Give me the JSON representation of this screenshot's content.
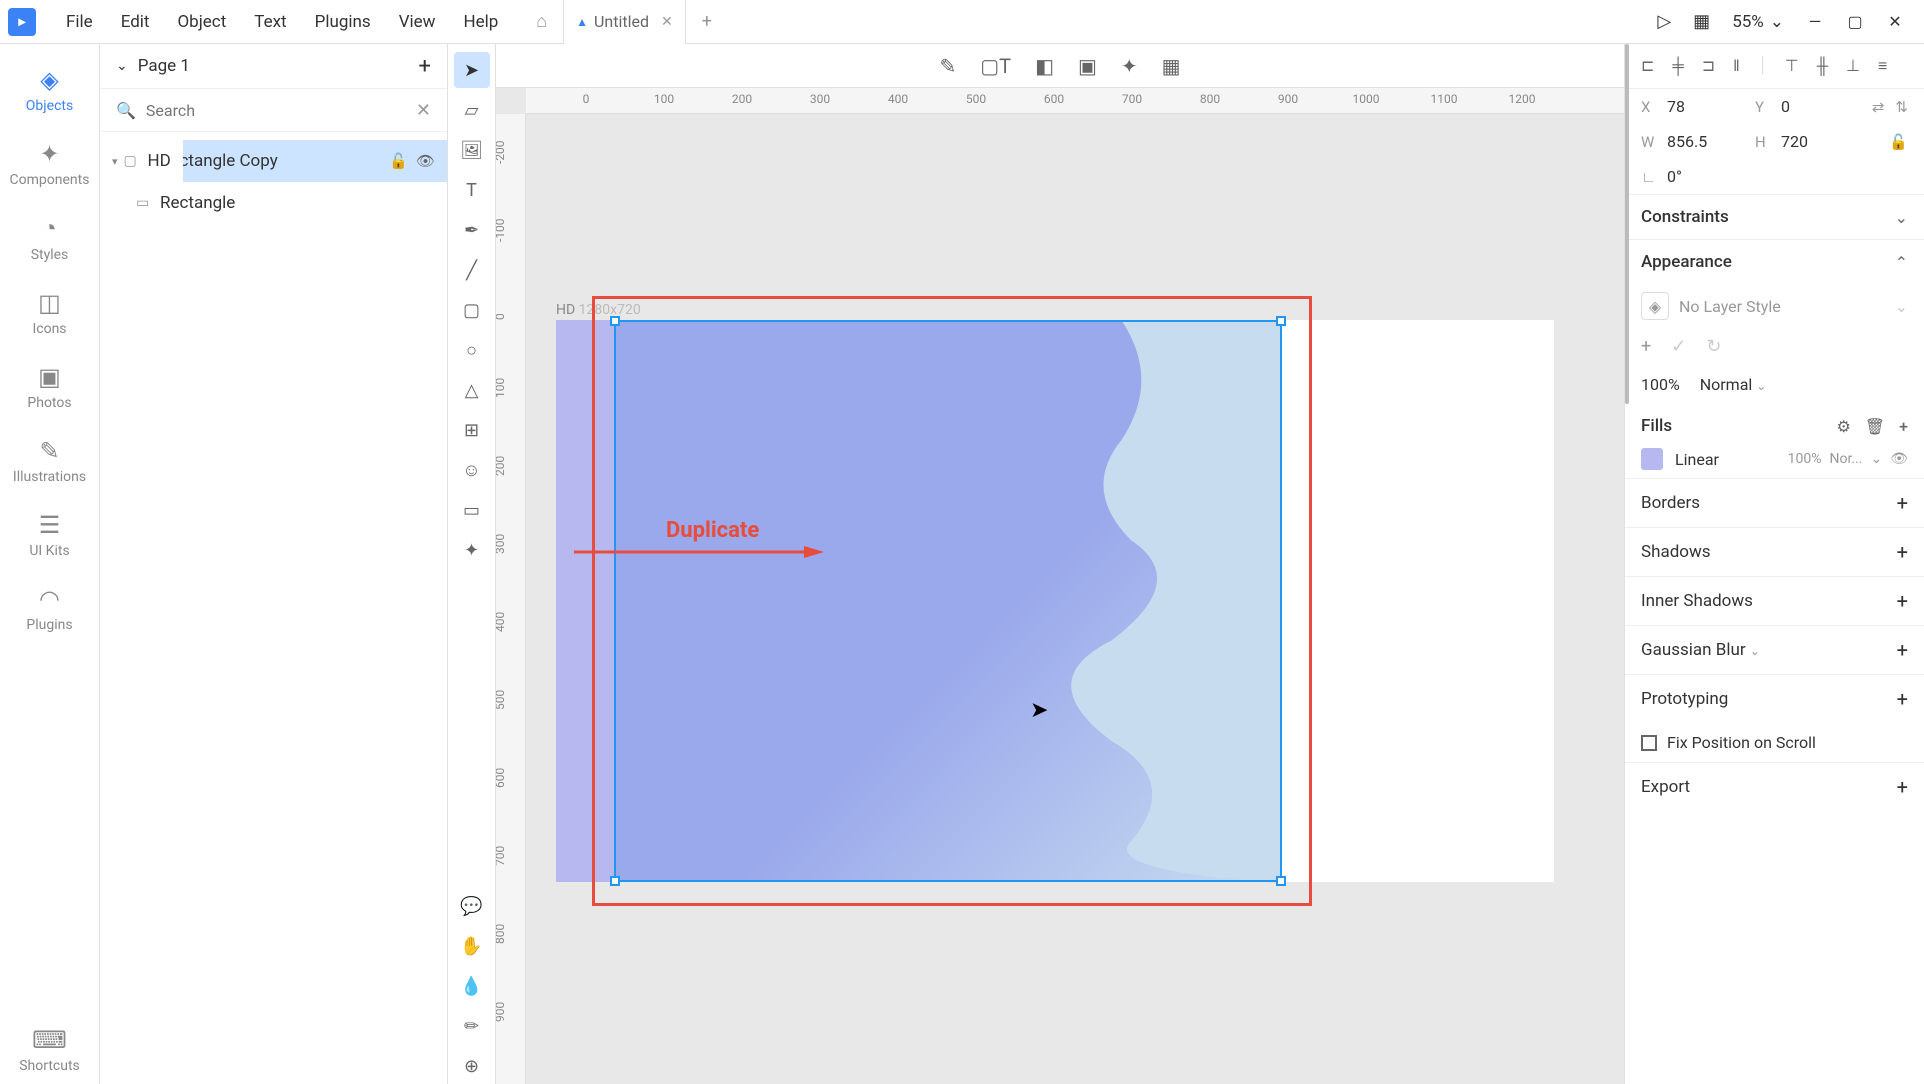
{
  "menubar": {
    "items": [
      "File",
      "Edit",
      "Object",
      "Text",
      "Plugins",
      "View",
      "Help"
    ],
    "tab_title": "Untitled",
    "zoom": "55%"
  },
  "far_left": {
    "items": [
      {
        "label": "Objects",
        "icon": "layers"
      },
      {
        "label": "Components",
        "icon": "components"
      },
      {
        "label": "Styles",
        "icon": "styles"
      },
      {
        "label": "Icons",
        "icon": "icons"
      },
      {
        "label": "Photos",
        "icon": "photos"
      },
      {
        "label": "Illustrations",
        "icon": "illustrations"
      },
      {
        "label": "UI Kits",
        "icon": "uikits"
      },
      {
        "label": "Plugins",
        "icon": "plugins"
      }
    ],
    "bottom": {
      "label": "Shortcuts",
      "icon": "keyboard"
    }
  },
  "pages": {
    "current": "Page 1"
  },
  "search": {
    "placeholder": "Search"
  },
  "layers": {
    "artboard": "HD",
    "items": [
      {
        "name": "Rectangle Copy",
        "selected": true
      },
      {
        "name": "Rectangle",
        "selected": false
      }
    ]
  },
  "canvas": {
    "artboard_label": "HD",
    "artboard_dims": "1280x720",
    "annotation_text": "Duplicate",
    "ruler_h": [
      "0",
      "100",
      "200",
      "300",
      "400",
      "500",
      "600",
      "700",
      "800",
      "900",
      "1000",
      "1100",
      "1200"
    ],
    "ruler_v": [
      "-200",
      "-100",
      "0",
      "100",
      "200",
      "300",
      "400",
      "500",
      "600",
      "700",
      "800",
      "900"
    ]
  },
  "props": {
    "x": "78",
    "y": "0",
    "w": "856.5",
    "h": "720",
    "rotation": "0°",
    "constraints_label": "Constraints",
    "appearance_label": "Appearance",
    "no_layer_style": "No Layer Style",
    "opacity": "100%",
    "blend_mode": "Normal",
    "fills_label": "Fills",
    "fill_type": "Linear",
    "fill_opacity": "100%",
    "fill_blend": "Nor...",
    "borders_label": "Borders",
    "shadows_label": "Shadows",
    "inner_shadows_label": "Inner Shadows",
    "blur_label": "Gaussian Blur",
    "proto_label": "Prototyping",
    "fix_position": "Fix Position on Scroll",
    "export_label": "Export"
  }
}
